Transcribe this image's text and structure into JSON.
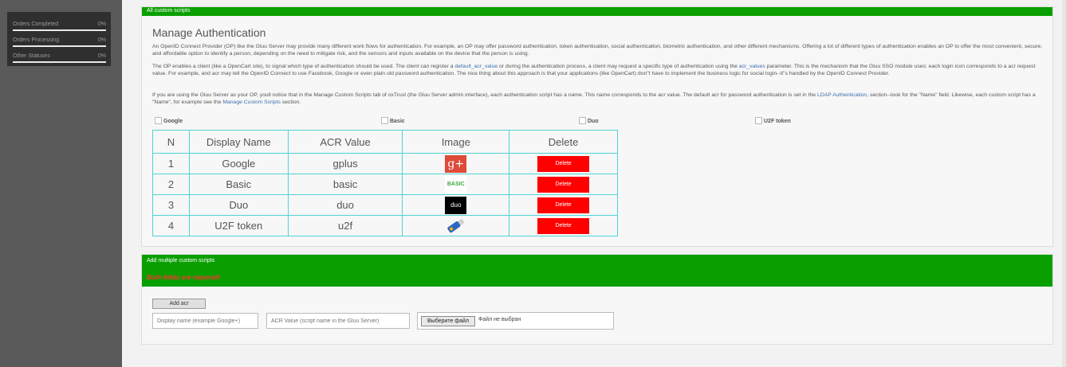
{
  "sidebar": {
    "stats": [
      {
        "label": "Orders Completed",
        "value": "0%"
      },
      {
        "label": "Orders Processing",
        "value": "0%"
      },
      {
        "label": "Other Statuses",
        "value": "0%"
      }
    ]
  },
  "custom_scripts": {
    "header": "All custom scripts",
    "title": "Manage Authentication",
    "p1": "An OpenID Connect Provider (OP) like the Gluu Server may provide many different work flows for authentication. For example, an OP may offer password authentication, token authentication, social authentication, biometric authentication, and other different mechanisms. Offering a lot of different types of authentication enables an OP to offer the most convenient, secure, and affordable option to identify a person, depending on the need to mitigate risk, and the sensors and inputs available on the device that the person is using.",
    "p2_a": "The OP enables a client (like a OpenCart site), to signal which type of authentication should be used. The client can register a ",
    "p2_link1": "default_acr_value",
    "p2_b": " or during the authentication process, a client may request a specific type of authentication using the ",
    "p2_link2": "acr_values",
    "p2_c": " parameter. This is the mechanism that the Gluu SSO module uses: each login icon corresponds to a acr request value. For example, and acr may tell the OpenID Connect to use Facebook, Google or even plain old password authentication. The nice thing about this approach is that your applications (like OpenCart) don\"t have to implement the business logic for social login--it\"s handled by the OpenID Connect Provider.",
    "p3_a": "If you are using the Gluu Server as your OP, youll notice that in the Manage Custom Scripts tab of oxTrust (the Gluu Server admin interface), each authentication script has a name. This name corresponds to the acr value. The default acr for password authentication is set in the ",
    "p3_link1": "LDAP Authentication",
    "p3_b": ", section--look for the \"Name\" field. Likewise, each custom script has a \"Name\", for example see the ",
    "p3_link2": "Manage Custom Scripts",
    "p3_c": " section.",
    "checkboxes": [
      "Google",
      "Basic",
      "Duo",
      "U2F token"
    ],
    "table": {
      "headers": [
        "N",
        "Display Name",
        "ACR Value",
        "Image",
        "Delete"
      ],
      "rows": [
        {
          "n": "1",
          "name": "Google",
          "acr": "gplus",
          "icon": "google-plus-icon",
          "delete": "Delete"
        },
        {
          "n": "2",
          "name": "Basic",
          "acr": "basic",
          "icon": "basic-icon",
          "delete": "Delete"
        },
        {
          "n": "3",
          "name": "Duo",
          "acr": "duo",
          "icon": "duo-icon",
          "delete": "Delete"
        },
        {
          "n": "4",
          "name": "U2F token",
          "acr": "u2f",
          "icon": "usb-key-icon",
          "delete": "Delete"
        }
      ]
    },
    "icon_text": {
      "google": "g+",
      "basic": "BASIC",
      "duo": "duo"
    }
  },
  "add_scripts": {
    "header": "Add multiple custom scripts",
    "required": "Both fields are required!",
    "add_button": "Add acr",
    "display_placeholder": "Display name (example Google+)",
    "acr_placeholder": "ACR Value (script name in the Gluu Server)",
    "file_button": "Выберите файл",
    "file_none": "Файл не выбран"
  },
  "colors": {
    "accent": "#0a9f00",
    "delete": "#ff0000",
    "table_border": "#4fd3d3",
    "link": "#3a6fb0"
  }
}
